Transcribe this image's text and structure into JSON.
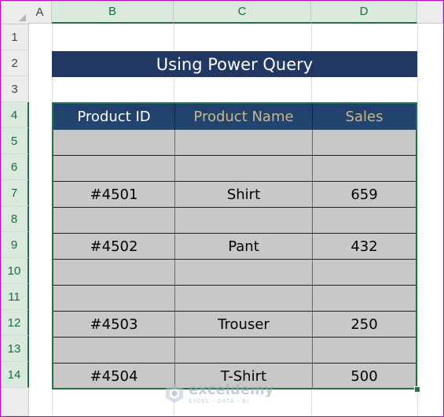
{
  "columns": [
    "A",
    "B",
    "C",
    "D"
  ],
  "rows": [
    "1",
    "2",
    "3",
    "4",
    "5",
    "6",
    "7",
    "8",
    "9",
    "10",
    "11",
    "12",
    "13",
    "14"
  ],
  "title": "Using Power Query",
  "table": {
    "headers": [
      "Product ID",
      "Product Name",
      "Sales"
    ],
    "header_colors": [
      "#ffffff",
      "#c9b98a",
      "#c9b98a"
    ],
    "rows": [
      [
        "",
        "",
        ""
      ],
      [
        "",
        "",
        ""
      ],
      [
        "#4501",
        "Shirt",
        "659"
      ],
      [
        "",
        "",
        ""
      ],
      [
        "#4502",
        "Pant",
        "432"
      ],
      [
        "",
        "",
        ""
      ],
      [
        "",
        "",
        ""
      ],
      [
        "#4503",
        "Trouser",
        "250"
      ],
      [
        "",
        "",
        ""
      ],
      [
        "#4504",
        "T-Shirt",
        "500"
      ]
    ]
  },
  "watermark": {
    "name": "exceldemy",
    "tagline": "EXCEL · DATA · BI"
  },
  "colors": {
    "title_bg": "#203864",
    "table_fill": "#c8c8c8",
    "selection": "#217346"
  }
}
